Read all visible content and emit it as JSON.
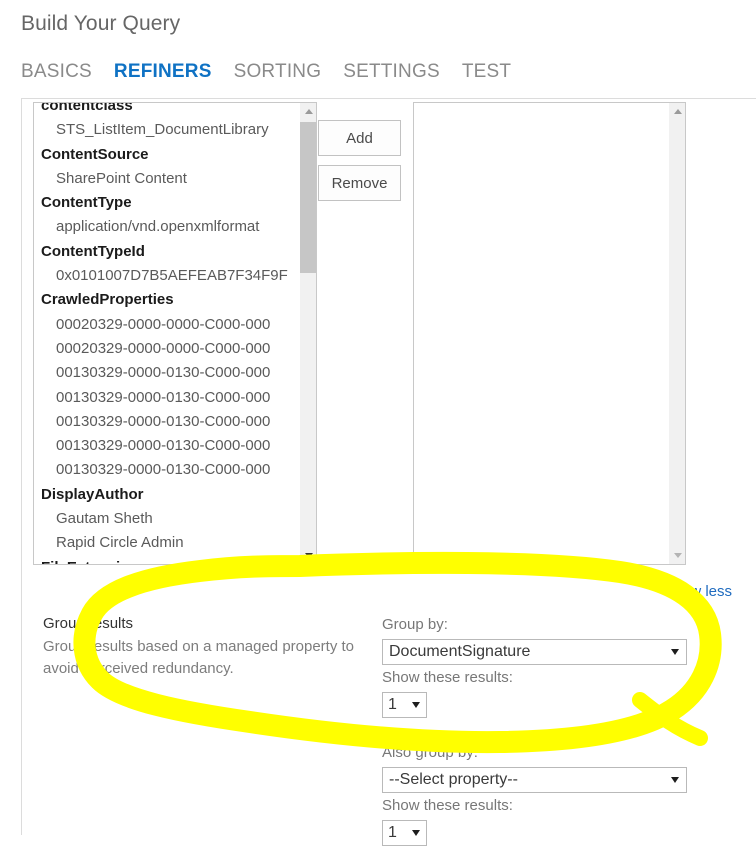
{
  "header": {
    "title": "Build Your Query"
  },
  "tabs": [
    {
      "id": "basics",
      "label": "BASICS",
      "active": false
    },
    {
      "id": "refiners",
      "label": "REFINERS",
      "active": true
    },
    {
      "id": "sorting",
      "label": "SORTING",
      "active": false
    },
    {
      "id": "settings",
      "label": "SETTINGS",
      "active": false
    },
    {
      "id": "test",
      "label": "TEST",
      "active": false
    }
  ],
  "refiners": {
    "available_items": [
      {
        "text": "contentclass",
        "type": "group"
      },
      {
        "text": "STS_ListItem_DocumentLibrary",
        "type": "child"
      },
      {
        "text": "ContentSource",
        "type": "group"
      },
      {
        "text": "SharePoint Content",
        "type": "child"
      },
      {
        "text": "ContentType",
        "type": "group"
      },
      {
        "text": "application/vnd.openxmlformat",
        "type": "child"
      },
      {
        "text": "ContentTypeId",
        "type": "group"
      },
      {
        "text": "0x0101007D7B5AEFEAB7F34F9F",
        "type": "child"
      },
      {
        "text": "CrawledProperties",
        "type": "group"
      },
      {
        "text": "00020329-0000-0000-C000-000",
        "type": "child"
      },
      {
        "text": "00020329-0000-0000-C000-000",
        "type": "child"
      },
      {
        "text": "00130329-0000-0130-C000-000",
        "type": "child"
      },
      {
        "text": "00130329-0000-0130-C000-000",
        "type": "child"
      },
      {
        "text": "00130329-0000-0130-C000-000",
        "type": "child"
      },
      {
        "text": "00130329-0000-0130-C000-000",
        "type": "child"
      },
      {
        "text": "00130329-0000-0130-C000-000",
        "type": "child"
      },
      {
        "text": "DisplayAuthor",
        "type": "group"
      },
      {
        "text": "Gautam Sheth",
        "type": "child"
      },
      {
        "text": "Rapid Circle Admin",
        "type": "child"
      },
      {
        "text": "FileExtension",
        "type": "group"
      }
    ],
    "selected_items": [],
    "add_label": "Add",
    "remove_label": "Remove"
  },
  "show_less_label": "Show less",
  "group_results": {
    "heading": "Group results",
    "description": "Group results based on a managed property to avoid perceived redundancy.",
    "primary": {
      "group_by_label": "Group by:",
      "group_by_value": "DocumentSignature",
      "show_results_label": "Show these results:",
      "show_results_value": "1"
    },
    "secondary": {
      "group_by_label": "Also group by:",
      "group_by_value": "--Select property--",
      "show_results_label": "Show these results:",
      "show_results_value": "1"
    }
  },
  "annotation": {
    "type": "yellow-highlighter-loop",
    "color": "#FFFF00"
  },
  "colors": {
    "accent": "#0f72c4",
    "link": "#1f6bbf",
    "highlight": "#FFFF00",
    "text": "#444444",
    "muted": "#7d7d7d"
  }
}
